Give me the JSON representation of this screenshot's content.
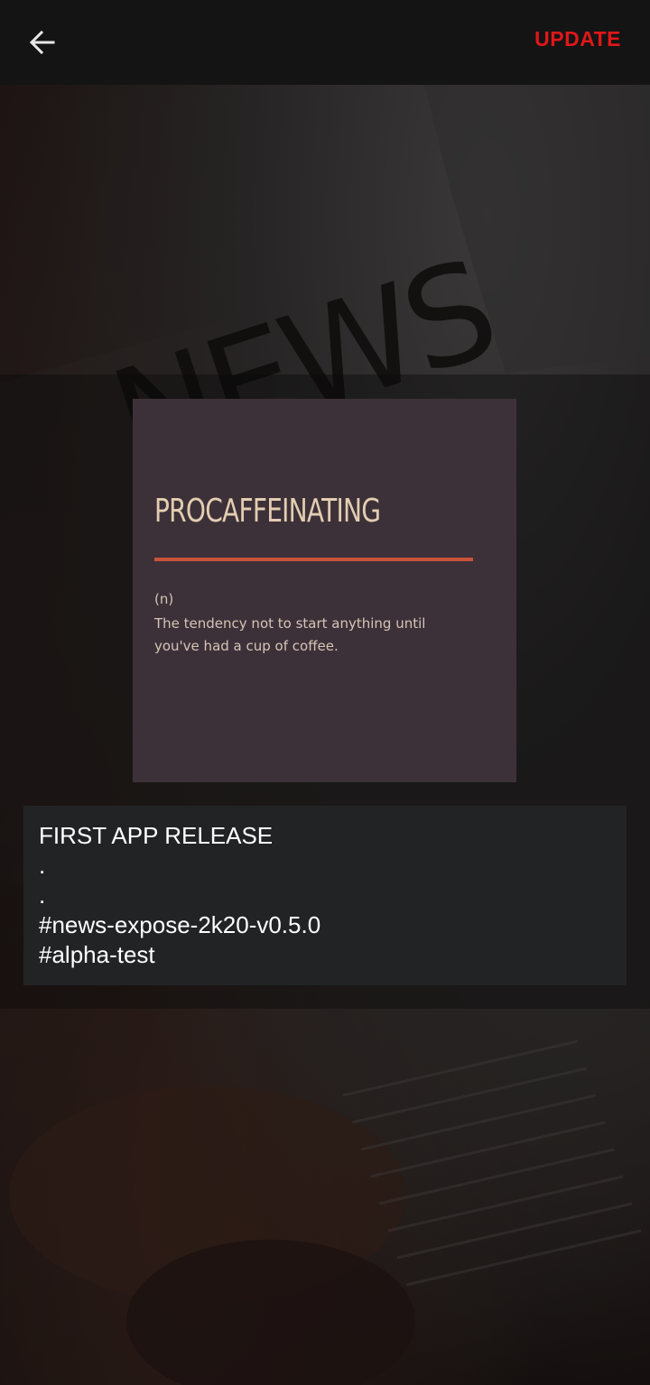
{
  "header": {
    "back_icon": "arrow-left-icon",
    "update_label": "UPDATE",
    "accent_color": "#e0171a"
  },
  "background": {
    "masthead_text": "NEWS"
  },
  "card": {
    "title": "PROCAFFEINATING",
    "part_of_speech": "(n)",
    "definition": "The tendency not to start anything until you've had a cup of coffee.",
    "rule_color": "#c9533a",
    "background_color": "#3d3139"
  },
  "caption": {
    "lines": [
      "FIRST APP RELEASE",
      ".",
      ".",
      "#news-expose-2k20-v0.5.0",
      "#alpha-test"
    ]
  }
}
